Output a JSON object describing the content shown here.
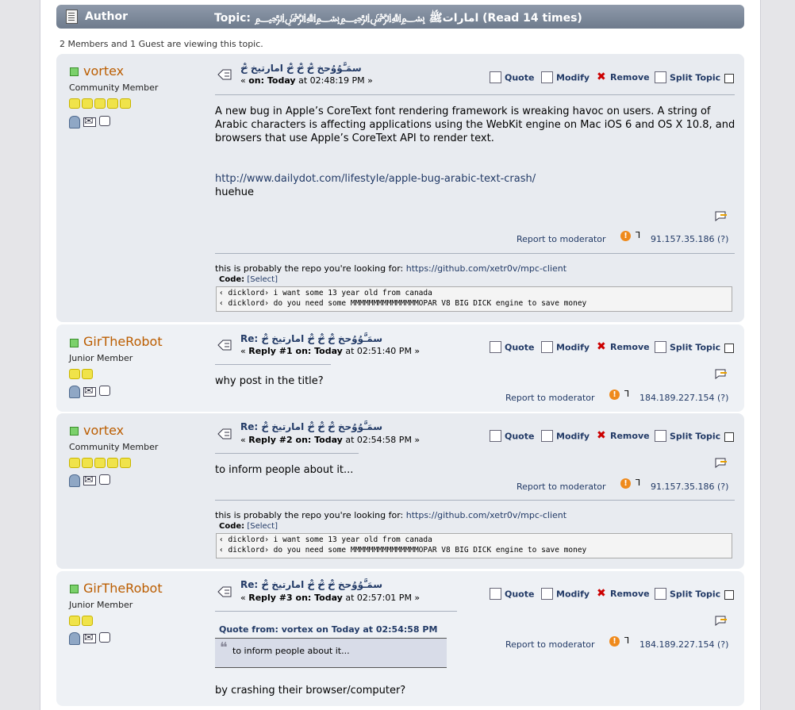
{
  "header": {
    "author_label": "Author",
    "topic_label": "Topic: ﷽﷽ اماراتﷺ (Read 14 times)"
  },
  "viewers": "2 Members and 1 Guest are viewing this topic.",
  "actions": {
    "quote": "Quote",
    "modify": "Modify",
    "remove": "Remove",
    "split": "Split Topic"
  },
  "report_label": "Report to moderator",
  "posts": [
    {
      "author": "vortex",
      "title": "Community Member",
      "stars": 5,
      "subject": "سمَـَّوُوُحخ ̷̴̐خ ̷̴̐خ ̷̴̐خ امارتيخ ̷̴̐خ",
      "meta_prefix": "« ",
      "meta_bold": "on: Today",
      "meta_suffix": " at 02:48:19 PM »",
      "body_lines": [
        "A new bug in Apple’s CoreText font rendering framework is wreaking havoc on users. A string of",
        "Arabic characters is affecting applications using the WebKit engine on Mac iOS 6 and OS X 10.8, and",
        "browsers that use Apple’s CoreText API to render text."
      ],
      "link": "http://www.dailydot.com/lifestyle/apple-bug-arabic-text-crash/",
      "extra": "huehue",
      "ip": "91.157.35.186 (?)"
    },
    {
      "author": "GirTheRobot",
      "title": "Junior Member",
      "stars": 2,
      "subject_re": "Re:",
      "subject": "سمَـَّوُوُحخ ̷̴̐خ ̷̴̐خ ̷̴̐خ امارتيخ ̷̴̐خ",
      "meta_prefix": "« ",
      "meta_bold": "Reply #1 on: Today",
      "meta_suffix": " at 02:51:40 PM »",
      "body": "why post in the title?",
      "ip": "184.189.227.154 (?)"
    },
    {
      "author": "vortex",
      "title": "Community Member",
      "stars": 5,
      "subject_re": "Re:",
      "subject": "سمَـَّوُوُحخ ̷̴̐خ ̷̴̐خ ̷̴̐خ امارتيخ ̷̴̐خ",
      "meta_prefix": "« ",
      "meta_bold": "Reply #2 on: Today",
      "meta_suffix": " at 02:54:58 PM »",
      "body": "to inform people about it...",
      "ip": "91.157.35.186 (?)"
    },
    {
      "author": "GirTheRobot",
      "title": "Junior Member",
      "stars": 2,
      "subject_re": "Re:",
      "subject": "سمَـَّوُوُحخ ̷̴̐خ ̷̴̐خ ̷̴̐خ امارتيخ ̷̴̐خ",
      "meta_prefix": "« ",
      "meta_bold": "Reply #3 on: Today",
      "meta_suffix": " at 02:57:01 PM »",
      "quote_header": "Quote from: vortex on Today at 02:54:58 PM",
      "quote_text": "to inform people about it...",
      "body": "by crashing their browser/computer?",
      "ip": "184.189.227.154 (?)"
    }
  ],
  "signature": {
    "text": "this is probably the repo you're looking for: ",
    "link": "https://github.com/xetr0v/mpc-client",
    "code_label": "Code:",
    "code_select": "[Select]",
    "code_lines": [
      "‹ dicklord› i want some 13 year old from canada",
      "‹ dicklord› do you need some MMMMMMMMMMMMMMMOPAR V8 BIG DICK engine to save money"
    ]
  }
}
